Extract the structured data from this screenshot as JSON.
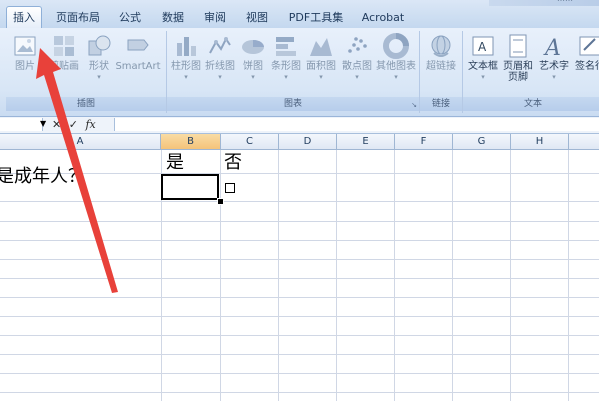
{
  "title_strip_text": "……",
  "tabs": [
    {
      "label": "插入",
      "active": true
    },
    {
      "label": "页面布局"
    },
    {
      "label": "公式"
    },
    {
      "label": "数据"
    },
    {
      "label": "审阅"
    },
    {
      "label": "视图"
    },
    {
      "label": "PDF工具集"
    },
    {
      "label": "Acrobat"
    }
  ],
  "groups": {
    "illustrations": {
      "label": "插图",
      "buttons": [
        "图片",
        "剪贴画",
        "形状",
        "SmartArt"
      ]
    },
    "charts": {
      "label": "图表",
      "buttons": [
        "柱形图",
        "折线图",
        "饼图",
        "条形图",
        "面积图",
        "散点图",
        "其他图表"
      ]
    },
    "links": {
      "label": "链接",
      "buttons": [
        "超链接"
      ]
    },
    "text": {
      "label": "文本",
      "buttons": [
        "文本框",
        "页眉和\n页脚",
        "艺术字",
        "签名行"
      ]
    }
  },
  "formula_bar": {
    "name_box": "",
    "cancel": "✕",
    "enter": "✓",
    "fx": "fx",
    "formula": ""
  },
  "columns": [
    "A",
    "B",
    "C",
    "D",
    "E",
    "F",
    "G",
    "H"
  ],
  "cells": {
    "B1": "是",
    "C1": "否",
    "A2": "是成年人？"
  },
  "colors": {
    "accent_arrow": "#e8413a",
    "ribbon_bg": "#dbe7f6",
    "selected_header": "#f4c37a"
  }
}
